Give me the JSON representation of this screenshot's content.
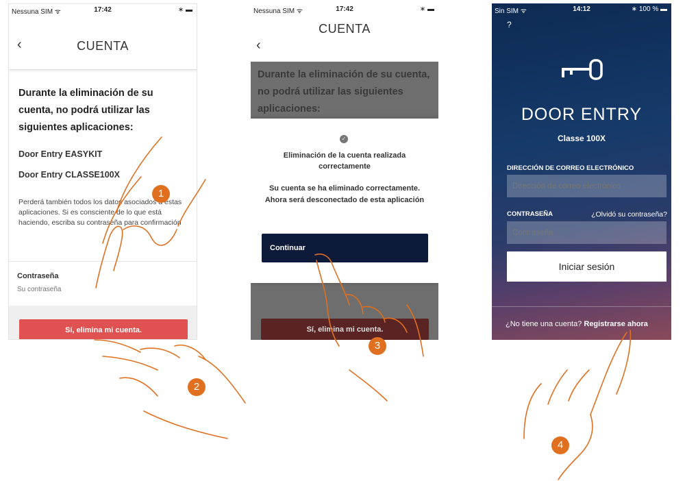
{
  "screen1": {
    "status": {
      "carrier": "Nessuna SIM ᯤ",
      "time": "17:42",
      "battery": "∗ ▬"
    },
    "title": "CUENTA",
    "back": "‹",
    "warning": "Durante la eliminación de su cuenta, no podrá utilizar las siguientes aplicaciones:",
    "apps": [
      "Door Entry EASYKIT",
      "Door Entry CLASSE100X"
    ],
    "note": "Perderá también todos los datos asociados a estas aplicaciones. Si es consciente de lo que está haciendo, escriba su contraseña para confirmación",
    "password_label": "Contraseña",
    "password_placeholder": "Su contraseña",
    "delete_button": "Sí, elimina mi cuenta."
  },
  "screen2": {
    "status": {
      "carrier": "Nessuna SIM ᯤ",
      "time": "17:42",
      "battery": "∗ ▬"
    },
    "title": "CUENTA",
    "back": "‹",
    "dim_warning": "Durante la eliminación de su cuenta, no podrá utilizar las siguientes aplicaciones:",
    "modal": {
      "check": "✓",
      "title_line1": "Eliminación de la cuenta realizada",
      "title_line2": "correctamente",
      "message_line1": "Su cuenta se ha eliminado correctamente.",
      "message_line2": "Ahora será desconectado de esta aplicación",
      "continue_button": "Continuar"
    },
    "delete_button": "Sí, elimina mi cuenta."
  },
  "screen3": {
    "status": {
      "carrier": "Sin SIM ᯤ",
      "time": "14:12",
      "battery": "∗ 100 % ▬"
    },
    "help": "?",
    "brand": "DOOR ENTRY",
    "model": "Classe 100X",
    "email_label": "DIRECCIÓN DE CORREO ELECTRÓNICO",
    "email_placeholder": "Dirección de correo electrónico",
    "password_label": "CONTRASEÑA",
    "forgot": "¿Olvidó su contraseña?",
    "password_placeholder": "Contraseña",
    "login_button": "Iniciar sesión",
    "signup_question": "¿No tiene una cuenta?",
    "signup_link": "Registrarse ahora"
  },
  "steps": [
    "1",
    "2",
    "3",
    "4"
  ],
  "colors": {
    "step_badge": "#e07020",
    "hand_outline": "#e07020",
    "delete_red": "#e05252",
    "continue_navy": "#0e1a3a"
  },
  "icons": [
    "wifi-icon",
    "bluetooth-icon",
    "battery-icon",
    "back-chevron-icon",
    "check-circle-icon",
    "key-icon",
    "pointing-hand-icon"
  ]
}
